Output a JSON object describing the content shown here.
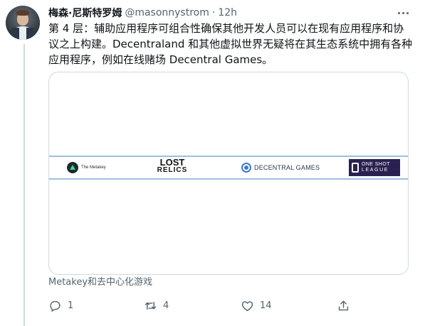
{
  "tweet": {
    "display_name": "梅森·尼斯特罗姆",
    "handle": "@masonnystrom",
    "separator": "·",
    "time": "12h",
    "text_lines": [
      "第 4 层：辅助应用程序可组合性确保其他开发人员可以在现有应用程序和协",
      "议之上构建。Decentraland 和其他虚拟世界无疑将在其生态系统中拥有各种",
      "应用程序，例如在线赌场 Decentral Games。"
    ]
  },
  "card": {
    "logos": {
      "metakey": "The Metakey",
      "lost_relics_line1": "LOST",
      "lost_relics_line2": "RELICS",
      "decentral_games": "DECENTRAL GAMES",
      "one_shot_line1": "ONE SHOT",
      "one_shot_line2": "LEAGUE"
    },
    "caption": "Metakey和去中心化游戏"
  },
  "actions": {
    "reply_count": "1",
    "retweet_count": "4",
    "like_count": "14",
    "icons": [
      "reply-icon",
      "retweet-icon",
      "like-icon",
      "share-icon"
    ]
  },
  "colors": {
    "secondary_text": "#536471",
    "card_border": "#cfd9de",
    "banner_border": "#9dbde3"
  }
}
